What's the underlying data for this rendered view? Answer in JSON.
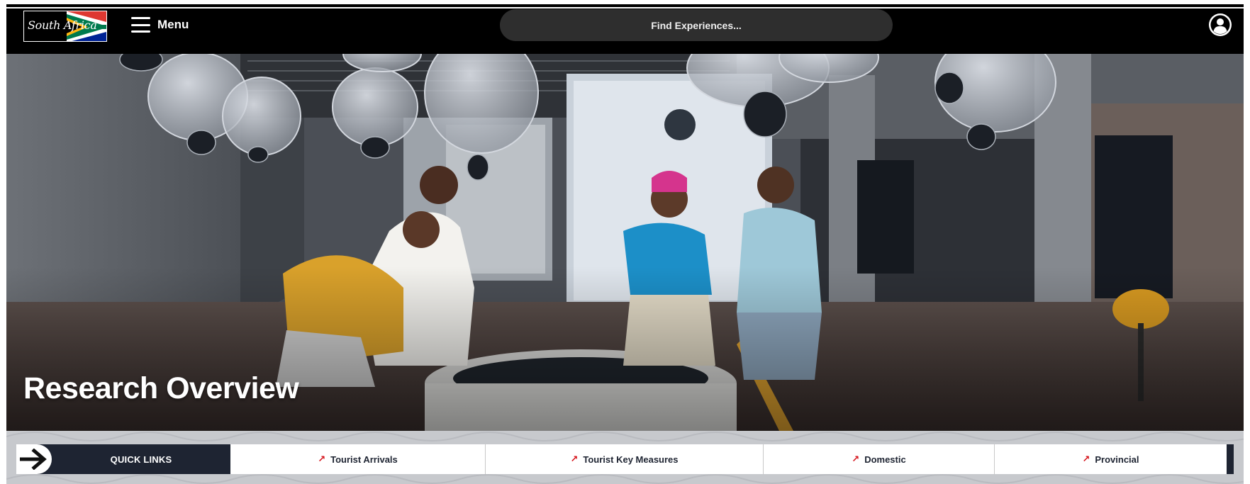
{
  "brand": {
    "logo_text": "South Africa",
    "flag_colors": [
      "#007a4d",
      "#de3831",
      "#002395",
      "#ffb612",
      "#000000",
      "#ffffff"
    ]
  },
  "navbar": {
    "menu_label": "Menu",
    "search_placeholder": "Find Experiences..."
  },
  "hero": {
    "title": "Research Overview"
  },
  "quick_links": {
    "label": "QUICK LINKS",
    "items": [
      {
        "label": "Tourist Arrivals"
      },
      {
        "label": "Tourist Key Measures"
      },
      {
        "label": "Domestic"
      },
      {
        "label": "Provincial"
      }
    ]
  },
  "colors": {
    "navbar_bg": "#000000",
    "search_bg": "#2e2e2e",
    "quicklinks_dark": "#1e2432",
    "accent_red": "#d6141c"
  },
  "icons": {
    "menu": "hamburger-icon",
    "profile": "user-circle-icon",
    "quick_links": "arrow-right-icon",
    "link": "arrow-up-right-icon"
  }
}
